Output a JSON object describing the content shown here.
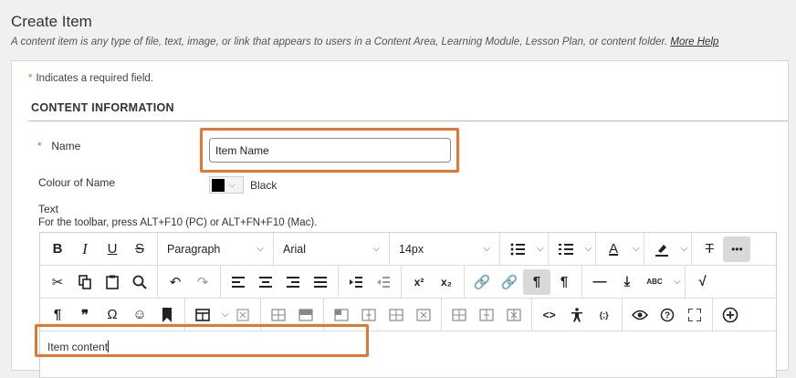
{
  "header": {
    "title": "Create Item",
    "description": "A content item is any type of file, text, image, or link that appears to users in a Content Area, Learning Module, Lesson Plan, or content folder.",
    "help_link": "More Help"
  },
  "form": {
    "required_star": "*",
    "required_note": "Indicates a required field.",
    "section_title": "CONTENT INFORMATION",
    "name_label": "Name",
    "name_value": "Item Name",
    "colour_label": "Colour of Name",
    "colour_value": "Black",
    "colour_hex": "#000000",
    "text_label": "Text",
    "toolbar_hint": "For the toolbar, press ALT+F10 (PC) or ALT+FN+F10 (Mac)."
  },
  "editor": {
    "paragraph_format": "Paragraph",
    "font_family": "Arial",
    "font_size": "14px",
    "content": "Item content",
    "icons": {
      "bold": "B",
      "italic": "I",
      "underline": "U",
      "strikethrough": "S",
      "bullet_list": "bullet-list-icon",
      "numbered_list": "numbered-list-icon",
      "text_color_letter": "A",
      "clear_format_letter": "T",
      "more": "•••",
      "superscript": "x²",
      "subscript": "x₂",
      "pilcrow": "¶",
      "quote": "❞",
      "omega": "Ω",
      "emoji": "☺",
      "ltr": "¶",
      "rtl": "¶",
      "code": "<>",
      "source": "{;}",
      "spell_label": "ABC"
    }
  },
  "colors": {
    "highlight": "#e57632",
    "required_star": "#d8731c"
  }
}
